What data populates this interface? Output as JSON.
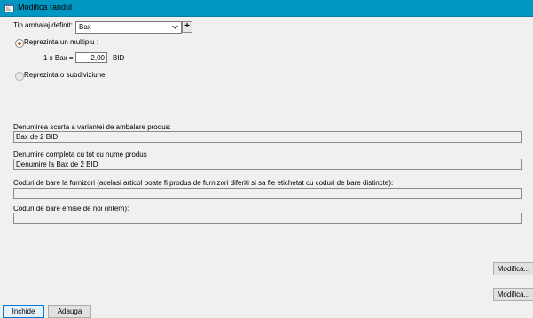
{
  "window": {
    "title": "Modifica randul",
    "icon": "form-icon"
  },
  "packaging": {
    "type_label": "Tip ambalaj definit:",
    "type_value": "Bax",
    "add_label": "+"
  },
  "options": {
    "multiple_label": "Reprezinta un multiplu :",
    "multiple_selected": true,
    "subdivision_label": "Reprezinta o subdiviziune",
    "subdivision_selected": false
  },
  "multiple": {
    "prefix_label": "1 x Bax =",
    "quantity": "2,00",
    "unit": "BID"
  },
  "fields": {
    "short_name_label": "Denumirea scurta a variantei de ambalare produs:",
    "short_name_value": "Bax de 2 BID",
    "full_name_label": "Denumire completa cu tot cu nume produs",
    "full_name_value": "Denumire la Bax de 2 BID",
    "supplier_barcodes_label": "Coduri de bare la furnizori (acelasi articol poate fi produs de furnizori diferiti si sa fie etichetat cu coduri de bare distincte):",
    "supplier_barcodes_value": "",
    "internal_barcodes_label": "Coduri de bare emise de noi (intern):",
    "internal_barcodes_value": ""
  },
  "buttons": {
    "modify_supplier": "Modifica...",
    "modify_internal": "Modifica...",
    "close": "Inchide",
    "add": "Adauga"
  },
  "colors": {
    "titlebar": "#0097c3",
    "radio_selected": "#c06a1a",
    "primary_button_border": "#0078d7"
  }
}
